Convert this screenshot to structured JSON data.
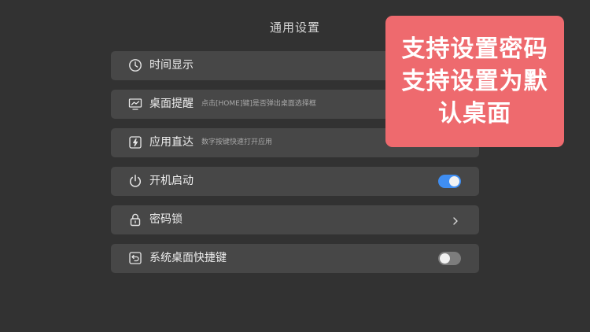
{
  "page": {
    "title": "通用设置"
  },
  "settings": [
    {
      "id": "time",
      "icon": "clock-icon",
      "label": "时间显示",
      "description": "",
      "control": "none"
    },
    {
      "id": "desktop-reminder",
      "icon": "monitor-icon",
      "label": "桌面提醒",
      "description": "点击[HOME]键]是否弹出桌面选择框",
      "control": "none"
    },
    {
      "id": "app-direct",
      "icon": "bolt-icon",
      "label": "应用直达",
      "description": "数字按键快速打开应用",
      "control": "none"
    },
    {
      "id": "boot-start",
      "icon": "power-icon",
      "label": "开机启动",
      "description": "",
      "control": "toggle",
      "toggle_on": true
    },
    {
      "id": "password-lock",
      "icon": "lock-icon",
      "label": "密码锁",
      "description": "",
      "control": "chevron"
    },
    {
      "id": "system-desktop-shortcut",
      "icon": "return-icon",
      "label": "系统桌面快捷键",
      "description": "",
      "control": "toggle",
      "toggle_on": false
    }
  ],
  "callout": {
    "lines": [
      "支持设置密码",
      "支持设置为默",
      "认桌面"
    ]
  },
  "colors": {
    "background": "#323232",
    "row": "#474747",
    "toggle_on": "#3f8ef2",
    "toggle_off": "#7d7d7d",
    "callout": "#ee6a6e"
  }
}
